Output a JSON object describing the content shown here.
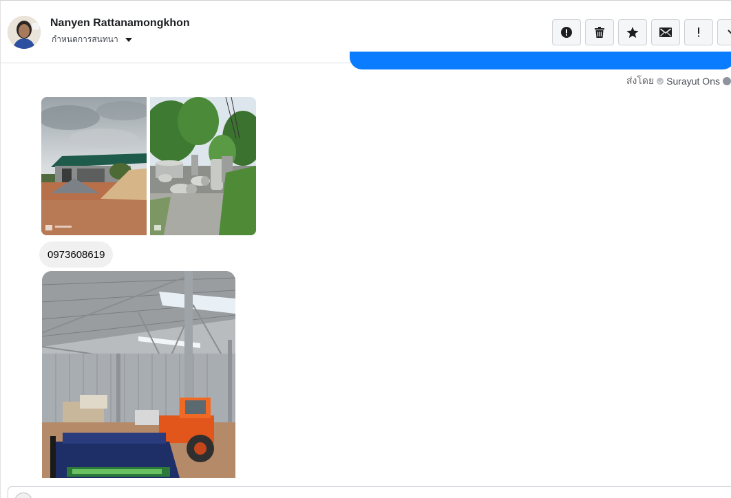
{
  "header": {
    "contact_name": "Nanyen Rattanamongkhon",
    "settings_label": "กำหนดการสนทนา",
    "actions": [
      {
        "name": "report-spam-button",
        "icon": "alert-circle-icon"
      },
      {
        "name": "delete-button",
        "icon": "trash-icon"
      },
      {
        "name": "star-button",
        "icon": "star-icon"
      },
      {
        "name": "mark-unread-button",
        "icon": "envelope-icon"
      },
      {
        "name": "important-button",
        "icon": "exclamation-icon"
      },
      {
        "name": "more-button",
        "icon": "chevron-down-icon"
      }
    ]
  },
  "conversation": {
    "sent_by_label": "ส่งโดย",
    "sent_by_name": "Surayut Ons",
    "phone_message": "0973608619",
    "photos": [
      {
        "subject": "warehouse with gravel and sand piles"
      },
      {
        "subject": "concrete pipes and rings in yard"
      },
      {
        "subject": "steel shed with trucks and orange tractor"
      }
    ]
  },
  "colors": {
    "sent_bubble": "#0a7cff",
    "received_bubble": "#f0f0f0",
    "divider": "#dadde1"
  }
}
